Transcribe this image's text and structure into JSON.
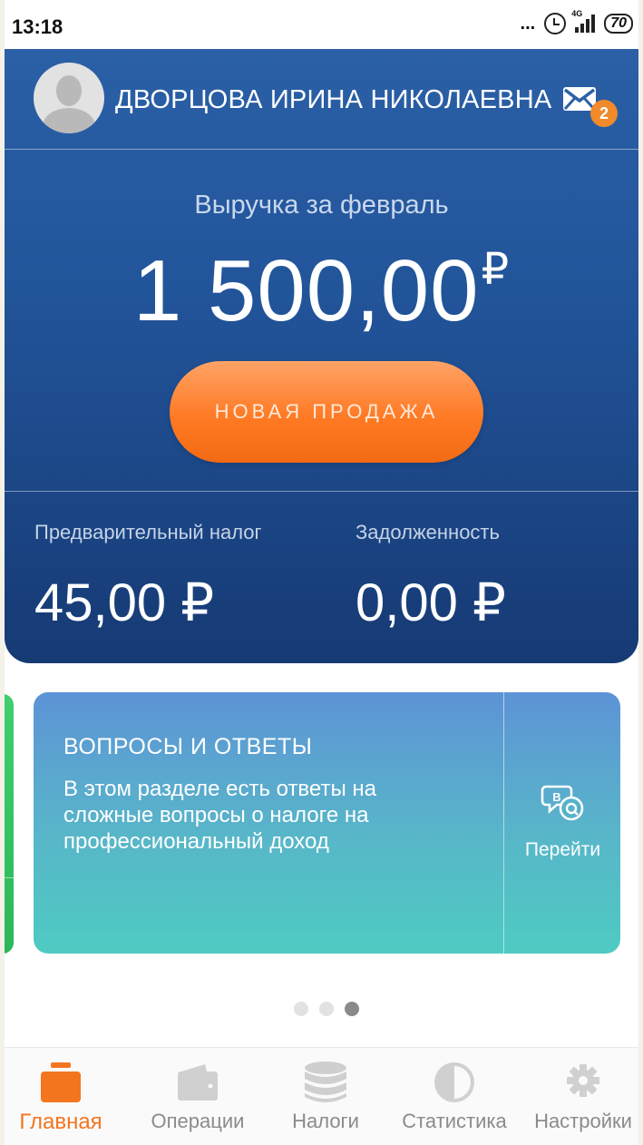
{
  "status_bar": {
    "time": "13:18",
    "dots": "...",
    "network": "4G",
    "battery": "70"
  },
  "header": {
    "user_name": "ДВОРЦОВА ИРИНА НИКОЛАЕВНА",
    "mail_badge": "2",
    "revenue_label": "Выручка за февраль",
    "revenue_amount": "1 500,00",
    "revenue_currency": "₽",
    "new_sale_label": "НОВАЯ ПРОДАЖА",
    "tax_label": "Предварительный налог",
    "tax_value": "45,00 ₽",
    "debt_label": "Задолженность",
    "debt_value": "0,00 ₽"
  },
  "carousel": {
    "title": "ВОПРОСЫ И ОТВЕТЫ",
    "text": "В этом разделе есть ответы на сложные вопросы о налоге на профессиональный доход",
    "go_label": "Перейти",
    "pages": 3,
    "active_page": 3
  },
  "bottom_nav": {
    "items": [
      {
        "label": "Главная",
        "icon": "briefcase-icon",
        "active": true
      },
      {
        "label": "Операции",
        "icon": "wallet-icon",
        "active": false
      },
      {
        "label": "Налоги",
        "icon": "coins-icon",
        "active": false
      },
      {
        "label": "Статистика",
        "icon": "pie-chart-icon",
        "active": false
      },
      {
        "label": "Настройки",
        "icon": "gear-icon",
        "active": false
      }
    ]
  },
  "colors": {
    "accent": "#f37520",
    "header_blue": "#22549a",
    "inactive": "#c8c8c8"
  }
}
